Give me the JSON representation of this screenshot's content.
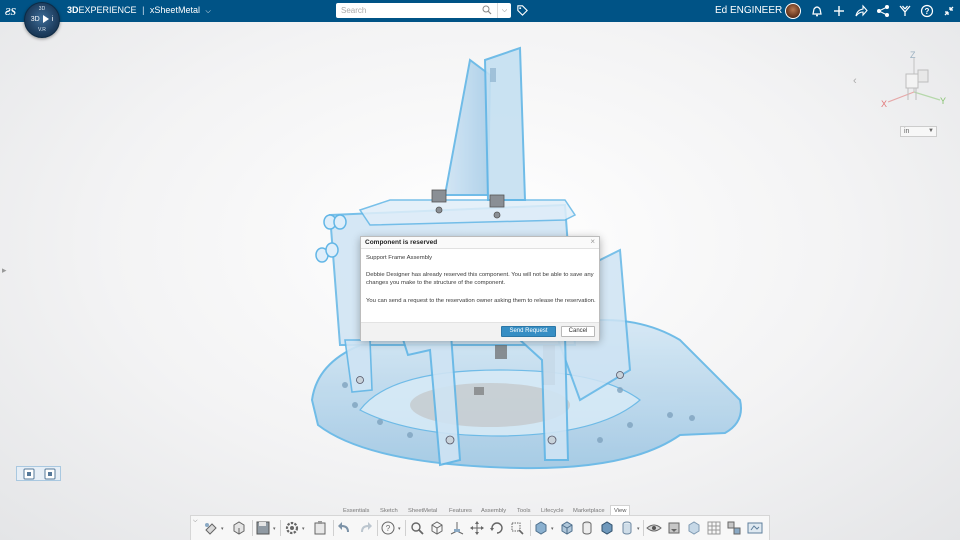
{
  "header": {
    "brand_bold": "3D",
    "brand_rest": "EXPERIENCE",
    "separator": "|",
    "app_name": "xSheetMetal",
    "compass": {
      "top": "3D",
      "left": "3D",
      "right": "i",
      "bottom": "V.R"
    },
    "search": {
      "placeholder": "Search",
      "value": ""
    },
    "user_name": "Ed ENGINEER",
    "icons": [
      "ds-logo-icon",
      "compass-icon",
      "search-icon",
      "tag-icon",
      "avatar",
      "notifications-icon",
      "add-icon",
      "share-icon",
      "network-icon",
      "tools-icon",
      "help-icon",
      "collapse-icon"
    ]
  },
  "viewport": {
    "unit": "in",
    "triad": {
      "x": "X",
      "y": "Y",
      "z": "Z"
    },
    "colors": {
      "model_fill": "#bfdcef",
      "model_outline": "#62b6e6",
      "header": "#005386",
      "accent": "#368ec4"
    }
  },
  "dialog": {
    "title": "Component is reserved",
    "close": "×",
    "component_name": "Support Frame Assembly",
    "message": "Debbie Designer has already reserved this component. You will not be able to save any changes you make to the structure of the component.",
    "hint": "You can send a request to the reservation owner asking them to release the reservation.",
    "send_button": "Send Request",
    "cancel_button": "Cancel"
  },
  "action_bar": {
    "sections": [
      "Essentials",
      "Sketch",
      "SheetMetal",
      "Features",
      "Assembly",
      "Tools",
      "Lifecycle",
      "Marketplace",
      "View"
    ],
    "active_section": "View",
    "tools": [
      "paint-icon",
      "cube-view-icon",
      "save-icon",
      "settings-icon",
      "clipboard-icon",
      "undo-icon",
      "redo-icon",
      "help-icon",
      "zoom-icon",
      "wireframe-icon",
      "axis-icon",
      "pan-icon",
      "rotate-icon",
      "zoom-box-icon",
      "shaded-icon",
      "box-icon",
      "cylinder-icon",
      "shaded-edges-icon",
      "transparent-icon",
      "eye-icon",
      "visibility-icon",
      "box-light-icon",
      "grid-icon",
      "layout-icon",
      "screen-icon"
    ]
  }
}
